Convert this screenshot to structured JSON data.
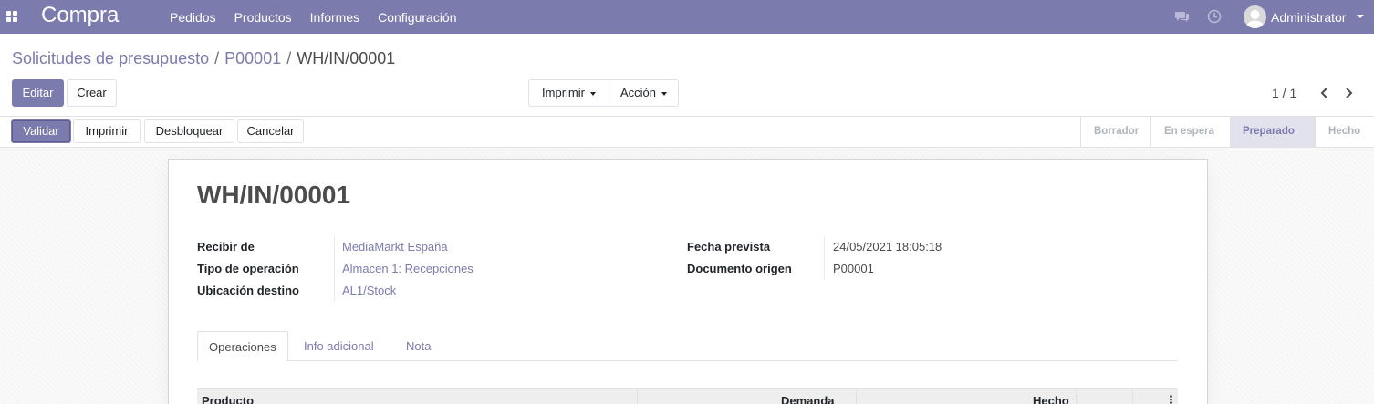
{
  "navbar": {
    "brand": "Compra",
    "menu": [
      "Pedidos",
      "Productos",
      "Informes",
      "Configuración"
    ],
    "user": "Administrator",
    "icons": [
      "apps-icon",
      "chat-icon",
      "clock-icon",
      "avatar",
      "caret-down-icon"
    ],
    "color": "#7c7bad"
  },
  "breadcrumb": {
    "items": [
      "Solicitudes de presupuesto",
      "P00001"
    ],
    "current": "WH/IN/00001",
    "separator": "/"
  },
  "actions": {
    "edit": "Editar",
    "create": "Crear",
    "print": "Imprimir",
    "action": "Acción"
  },
  "pager": {
    "value": "1 / 1"
  },
  "statusbar": {
    "buttons": {
      "validate": "Validar",
      "print": "Imprimir",
      "unlock": "Desbloquear",
      "cancel": "Cancelar"
    },
    "stages": [
      "Borrador",
      "En espera",
      "Preparado",
      "Hecho"
    ],
    "current_stage": "Preparado"
  },
  "record": {
    "title": "WH/IN/00001",
    "left_fields": [
      {
        "label": "Recibir de",
        "value": "MediaMarkt España"
      },
      {
        "label": "Tipo de operación",
        "value": "Almacen 1: Recepciones"
      },
      {
        "label": "Ubicación destino",
        "value": "AL1/Stock"
      }
    ],
    "right_fields": [
      {
        "label": "Fecha prevista",
        "value": "24/05/2021 18:05:18"
      },
      {
        "label": "Documento origen",
        "value": "P00001"
      }
    ]
  },
  "tabs": [
    "Operaciones",
    "Info adicional",
    "Nota"
  ],
  "table": {
    "columns": [
      "Producto",
      "Demanda",
      "Hecho"
    ]
  }
}
